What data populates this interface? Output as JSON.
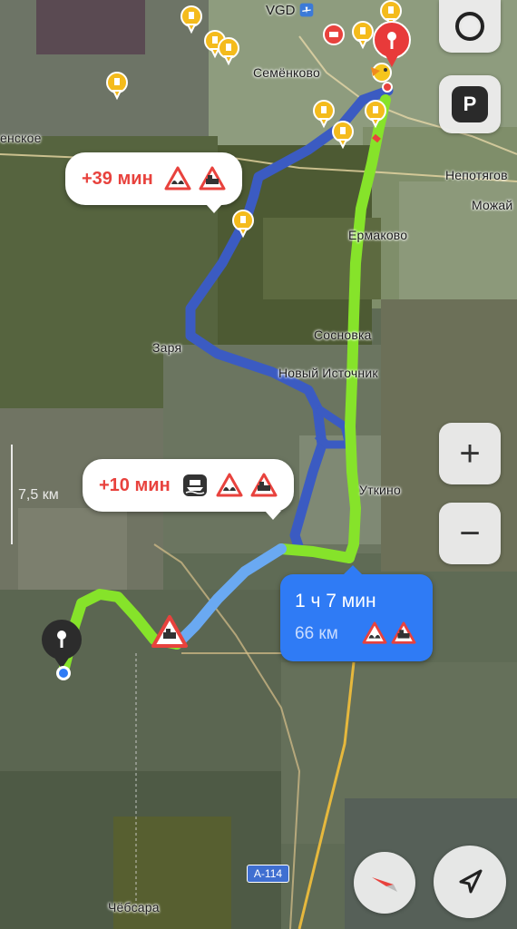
{
  "places": {
    "airport_code": "VGD",
    "semenkovo": "Семёнково",
    "enskoe": "енское",
    "nepotyagovo": "Непотягов",
    "mozhay": "Можай",
    "ermakovo": "Ермаково",
    "sosnovka": "Сосновка",
    "zarya": "Заря",
    "novy_istochnik": "Новый Источник",
    "utkino": "Уткино",
    "chebsara": "Чёбсара"
  },
  "road_badge": "А-114",
  "scale": {
    "label": "7,5 км"
  },
  "alt_routes": [
    {
      "delta": "+39 мин",
      "icons": [
        "road-bump-warning-icon",
        "railway-crossing-warning-icon"
      ]
    },
    {
      "delta": "+10 мин",
      "icons": [
        "ferry-icon",
        "road-bump-warning-icon",
        "railway-crossing-warning-icon"
      ]
    }
  ],
  "main_route": {
    "time": "1 ч 7 мин",
    "distance": "66 км",
    "icons": [
      "road-bump-warning-icon",
      "railway-crossing-warning-icon"
    ]
  },
  "controls": {
    "parking_label": "P",
    "zoom_in": "+",
    "zoom_out": "−"
  },
  "colors": {
    "route_green": "#86e32a",
    "route_lightblue": "#6aa9f2",
    "alt_route_blue": "#4263c9",
    "route_card": "#2f7bf5",
    "delay_red": "#e8423d",
    "destination_pin": "#e83a3a",
    "poi_yellow": "#f4bb1c"
  }
}
